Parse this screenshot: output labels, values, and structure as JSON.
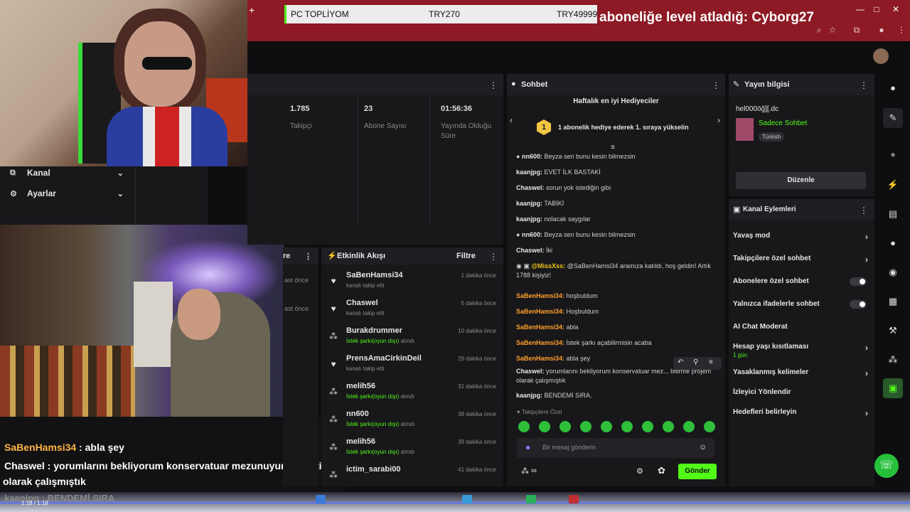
{
  "browser": {
    "plus": "+",
    "pc_product": "PC TOPLİYOM",
    "price_current": "TRY270",
    "price_target": "TRY49999",
    "subscription_banner": "aboneliğe level atladığ: Cyborg27",
    "window_buttons": [
      "—",
      "□",
      "✕"
    ]
  },
  "nav": {
    "kanal": "Kanal",
    "ayarlar": "Ayarlar"
  },
  "stats": {
    "followers_value": "1.785",
    "followers_label": "Takipçi",
    "subs_value": "23",
    "subs_label": "Abone Sayısı",
    "uptime_value": "01:56:36",
    "uptime_label": "Yayında Olduğu Süre"
  },
  "recent_panel": {
    "title": "re",
    "time1": "ast önce",
    "time2": "ast önce"
  },
  "activity": {
    "title": "Etkinlik Akışı",
    "filter": "Filtre",
    "items": [
      {
        "name": "SaBenHamsi34",
        "desc": "kanalı takip etti",
        "desc_hl": "",
        "time": "1 dakika önce",
        "icon": "heart-icon"
      },
      {
        "name": "Chaswel",
        "desc": "kanalı takip etti",
        "desc_hl": "",
        "time": "5 dakika önce",
        "icon": "heart-icon"
      },
      {
        "name": "Burakdrummer",
        "desc": " alındı",
        "desc_hl": "İstek şarkı(oyun dışı)",
        "time": "10 dakika önce",
        "icon": "reward-icon"
      },
      {
        "name": "PrensAmaCirkinDeil",
        "desc": "kanalı takip etti",
        "desc_hl": "",
        "time": "29 dakika önce",
        "icon": "heart-icon"
      },
      {
        "name": "melih56",
        "desc": " alındı",
        "desc_hl": "İstek şarkı(oyun dışı)",
        "time": "31 dakika önce",
        "icon": "reward-icon"
      },
      {
        "name": "nn600",
        "desc": " alındı",
        "desc_hl": "İstek şarkı(oyun dışı)",
        "time": "38 dakika önce",
        "icon": "reward-icon"
      },
      {
        "name": "melih56",
        "desc": " alındı",
        "desc_hl": "İstek şarkı(oyun dışı)",
        "time": "39 dakika önce",
        "icon": "reward-icon"
      },
      {
        "name": "ictim_sarabi00",
        "desc": "",
        "desc_hl": "",
        "time": "41 dakika önce",
        "icon": "reward-icon"
      }
    ]
  },
  "chat": {
    "title": "Sohbet",
    "gifter_title": "Haftalık en iyi Hediyeciler",
    "gifter_rank": "1",
    "gifter_text": "1 abonelik hediye ederek 1. sıraya yükselin",
    "messages": [
      {
        "user": "nn600:",
        "text": " Beyza sen bunu kesin bilmezsin",
        "color": "u-white",
        "prefix": "●"
      },
      {
        "user": "kaanjpg:",
        "text": " EVET İLK BASTAKİ",
        "color": "u-white",
        "prefix": ""
      },
      {
        "user": "Chaswel:",
        "text": " sorun yok istediğin gibi",
        "color": "u-white",
        "prefix": ""
      },
      {
        "user": "kaanjpg:",
        "text": " TABİKİ",
        "color": "u-white",
        "prefix": ""
      },
      {
        "user": "kaanjpg:",
        "text": " nolacak saygılar",
        "color": "u-white",
        "prefix": ""
      },
      {
        "user": "nn600:",
        "text": " Beyza sen bunu kesin bilmezsin",
        "color": "u-white",
        "prefix": "●"
      },
      {
        "user": "Chaswel:",
        "text": " İki",
        "color": "u-white",
        "prefix": ""
      },
      {
        "user": "@MissXss:",
        "text": " @SaBenHamsi34 aramıza katıldı, hoş geldin! Artık 1788 kişiyiz!",
        "color": "u-yellow",
        "prefix": "◉ ▣"
      },
      {
        "user": "SaBenHamsi34:",
        "text": " hoşbuldum",
        "color": "u-orange",
        "prefix": ""
      },
      {
        "user": "SaBenHamsi34:",
        "text": " Hoşbuldum",
        "color": "u-orange",
        "prefix": ""
      },
      {
        "user": "SaBenHamsi34:",
        "text": " abla",
        "color": "u-orange",
        "prefix": ""
      },
      {
        "user": "SaBenHamsi34:",
        "text": " İstek şarkı açabilirmisin acaba",
        "color": "u-orange",
        "prefix": ""
      },
      {
        "user": "SaBenHamsi34:",
        "text": " abla şey",
        "color": "u-orange",
        "prefix": ""
      },
      {
        "user": "Chaswel:",
        "text": " yorumlarını bekliyorum konservatuar mez... bitirme projem olarak çalışmıştık",
        "color": "u-white",
        "prefix": ""
      },
      {
        "user": "kaanjpg:",
        "text": " BENDEMİ SIRA.",
        "color": "u-white",
        "prefix": ""
      }
    ],
    "emote_label": "♥ Takipçilere Özel",
    "input_placeholder": "Bir mesaj gönderin",
    "send_label": "Gönder",
    "points": "∞"
  },
  "info": {
    "title": "Yayın bilgisi",
    "stream_title": "hel000öğ][.dc",
    "category": "Sadece Sohbet",
    "language": "Türkish",
    "edit_label": "Düzenle"
  },
  "actions": {
    "title": "Kanal Eylemleri",
    "rows": [
      {
        "label": "Yavaş mod",
        "sub": "",
        "control": "chevron"
      },
      {
        "label": "Takipçilere özel sohbet",
        "sub": "",
        "control": "chevron"
      },
      {
        "label": "Abonelere özel sohbet",
        "sub": "",
        "control": "toggle"
      },
      {
        "label": "Yalnızca ifadelerle sohbet",
        "sub": "",
        "control": "toggle"
      },
      {
        "label": "AI Chat Moderat",
        "sub": "",
        "control": "none"
      },
      {
        "label": "Hesap yaşı kısıtlaması",
        "sub": "1 gün",
        "control": "chevron"
      },
      {
        "label": "Yasaklanmış kelimeler",
        "sub": "",
        "control": "chevron"
      },
      {
        "label": "İzleyici Yönlendir",
        "sub": "",
        "control": "none"
      },
      {
        "label": "Hedefleri belirleyin",
        "sub": "",
        "control": "chevron"
      }
    ]
  },
  "overlay": {
    "line1_user": "SaBenHamsi34",
    "line1_text": " : abla şey",
    "line2_user": "Chaswel",
    "line2_text": " : yorumlarını bekliyorum konservatuar mezunuyum da bitirme pr",
    "line3_text": "olarak çalışmıştık",
    "bottom": "kaanjpg : BENDEMİ SIRA",
    "player_time": "1:18 / 1:18"
  },
  "colors": {
    "accent": "#53fc18",
    "banner": "#8d1a24",
    "panel": "#18181b"
  }
}
